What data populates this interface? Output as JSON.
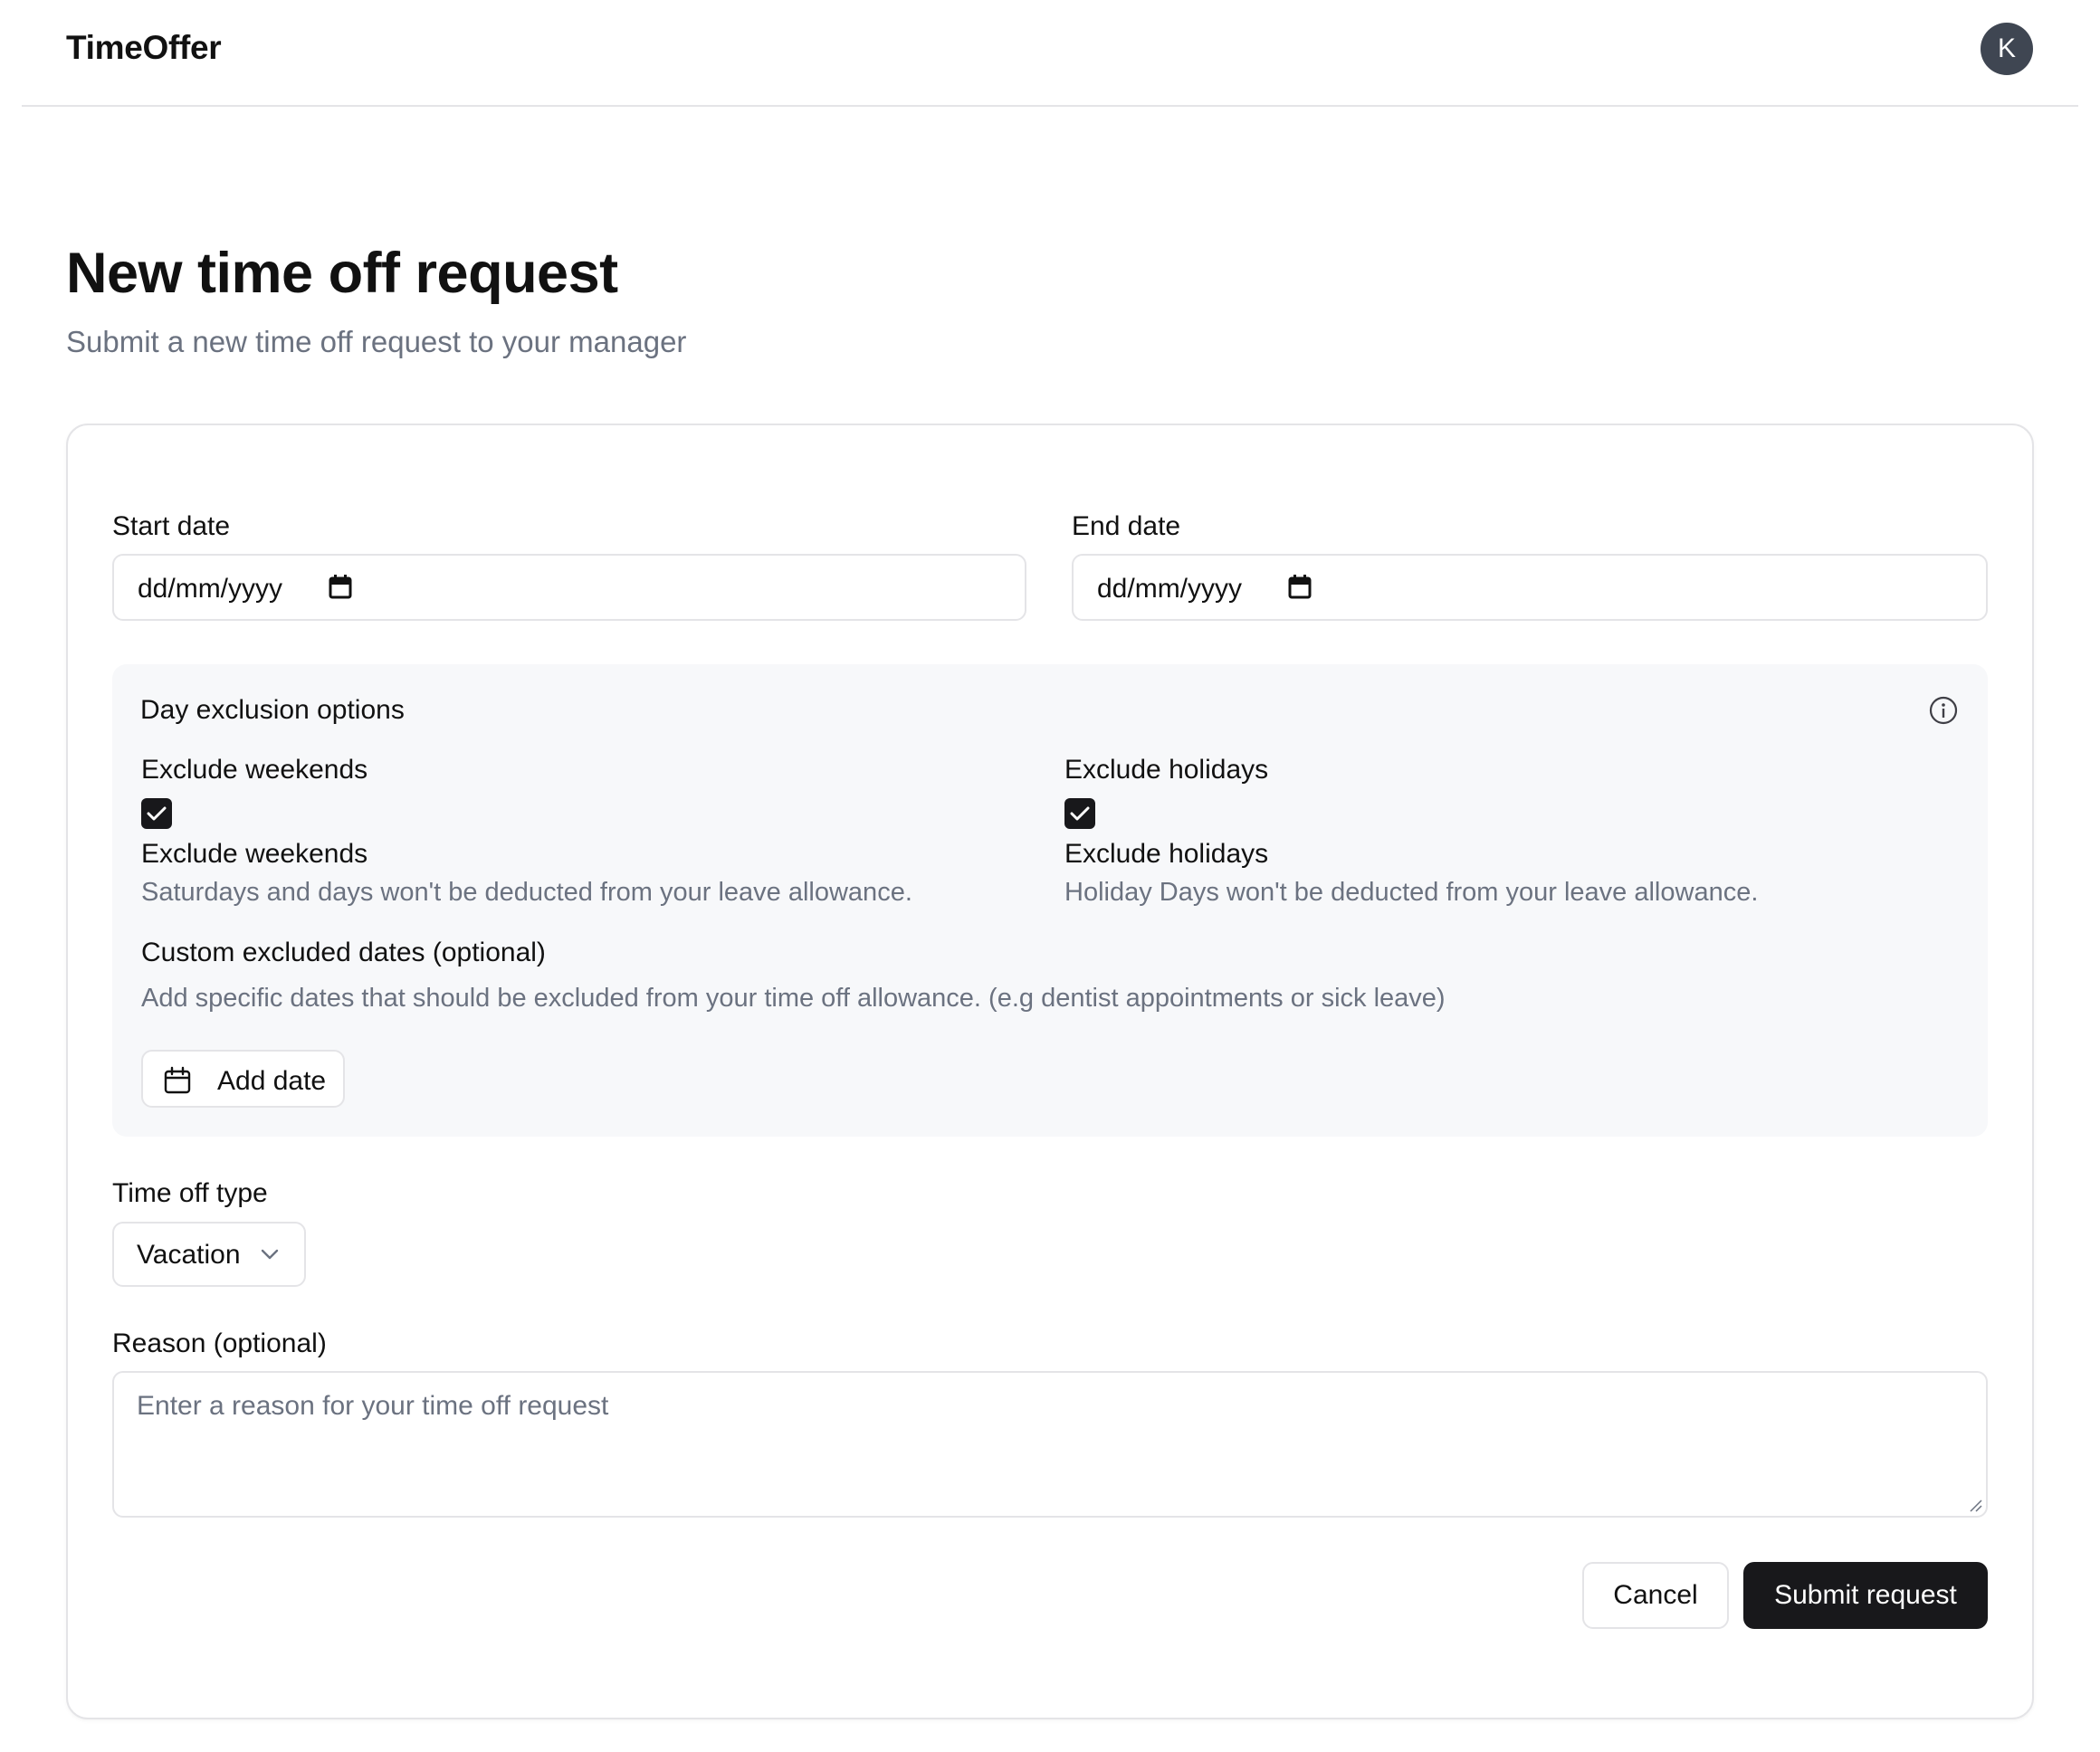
{
  "app": {
    "name": "TimeOffer",
    "avatar_initial": "K"
  },
  "page": {
    "title": "New time off request",
    "subtitle": "Submit a new time off request to your manager"
  },
  "form": {
    "start_date": {
      "label": "Start date",
      "placeholder": "dd/mm/yyyy"
    },
    "end_date": {
      "label": "End date",
      "placeholder": "dd/mm/yyyy"
    },
    "exclusion": {
      "title": "Day exclusion options",
      "weekends": {
        "label": "Exclude weekends",
        "checked": true,
        "title": "Exclude weekends",
        "description": "Saturdays and days won't be deducted from your leave allowance."
      },
      "holidays": {
        "label": "Exclude holidays",
        "checked": true,
        "title": "Exclude holidays",
        "description": "Holiday Days won't be deducted from your leave allowance."
      },
      "custom": {
        "title": "Custom excluded dates (optional)",
        "description": "Add specific dates that should be excluded from your time off allowance. (e.g dentist appointments or sick leave)",
        "add_button": "Add date"
      }
    },
    "type": {
      "label": "Time off type",
      "value": "Vacation"
    },
    "reason": {
      "label": "Reason (optional)",
      "placeholder": "Enter a reason for your time off request"
    },
    "actions": {
      "cancel": "Cancel",
      "submit": "Submit request"
    }
  },
  "colors": {
    "primary": "#18181b",
    "muted_text": "#6b7280",
    "border": "#e4e4e7",
    "panel_bg": "#f7f8fa",
    "avatar_bg": "#3f4652"
  }
}
